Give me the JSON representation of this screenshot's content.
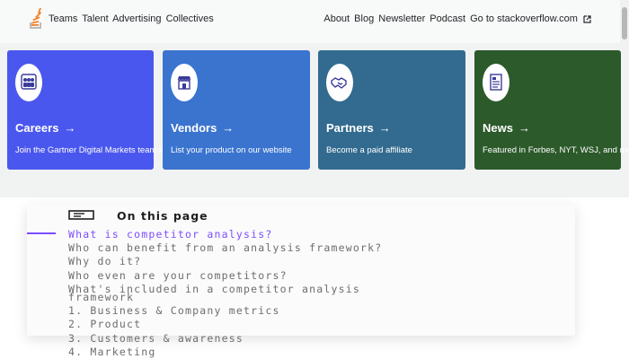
{
  "header": {
    "logo_icon": "stack-overflow-logo-icon",
    "brand_links": [
      "Teams",
      "Talent",
      "Advertising",
      "Collectives"
    ],
    "nav_links": [
      "About",
      "Blog",
      "Newsletter",
      "Podcast",
      "Go to stackoverflow.com"
    ],
    "external_icon": "external-link-icon"
  },
  "cards": [
    {
      "icon": "people-icon",
      "title": "Careers",
      "arrow": "→",
      "desc": "Join the Gartner Digital Markets team in Austin",
      "color": "#4a57ee"
    },
    {
      "icon": "storefront-icon",
      "title": "Vendors",
      "arrow": "→",
      "desc": "List your product on our website",
      "color": "#3b74cf"
    },
    {
      "icon": "handshake-icon",
      "title": "Partners",
      "arrow": "→",
      "desc": "Become a paid affiliate",
      "color": "#326b8f"
    },
    {
      "icon": "document-icon",
      "title": "News",
      "arrow": "→",
      "desc": "Featured in Forbes, NYT, WSJ, and more",
      "color": "#2c5a2b"
    }
  ],
  "toc": {
    "icon": "list-box-icon",
    "heading": "On this page",
    "accent": "#7c4dff",
    "items": [
      "What is competitor analysis?",
      "Who can benefit from an analysis framework?",
      "Why do it?",
      "Who even are your competitors?",
      "What's included in a competitor analysis",
      "framework",
      "1. Business & Company metrics",
      "2. Product",
      "3. Customers & awareness",
      "4. Marketing"
    ]
  }
}
